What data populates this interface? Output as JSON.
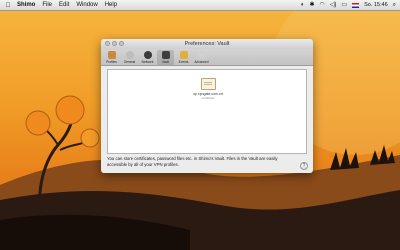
{
  "menubar": {
    "apple_icon": "apple-icon",
    "items": [
      "Shimo",
      "File",
      "Edit",
      "Window",
      "Help"
    ],
    "clock": "So. 15:46"
  },
  "window": {
    "title": "Preferences: Vault",
    "toolbar": [
      {
        "label": "Profiles",
        "icon": "profiles-icon",
        "color": "#c98a3d"
      },
      {
        "label": "General",
        "icon": "general-icon",
        "color": "#bdbdbd"
      },
      {
        "label": "Network",
        "icon": "network-icon",
        "color": "#3a3a3a"
      },
      {
        "label": "Vault",
        "icon": "vault-icon",
        "color": "#3f3f3f",
        "active": true
      },
      {
        "label": "Events",
        "icon": "events-icon",
        "color": "#e0b13a"
      },
      {
        "label": "Advanced",
        "icon": "advanced-icon",
        "color": "#d0d0d0"
      }
    ],
    "file": {
      "name": "op.vpngate.com.crt",
      "sub": "certificate"
    },
    "info_text": "You can store certificates, password files etc. in Shimo's Vault. Files in the Vault are easily accessible by all of your VPN profiles.",
    "help": "?"
  }
}
